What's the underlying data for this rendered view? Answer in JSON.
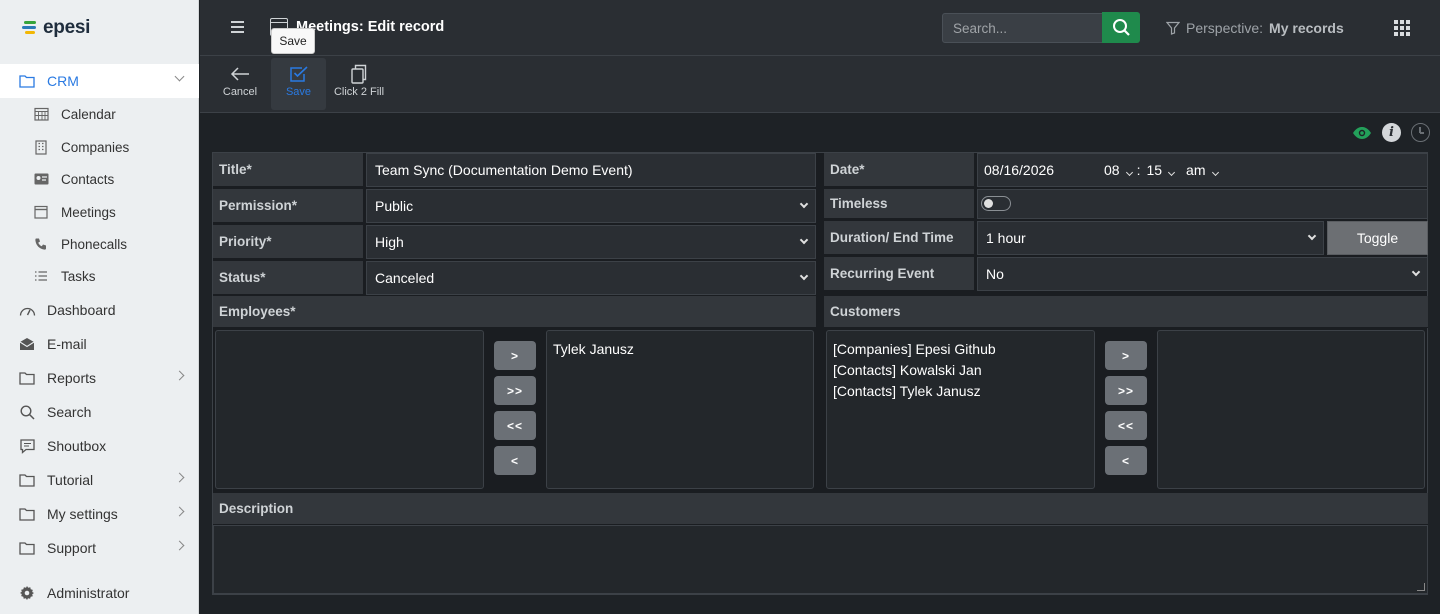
{
  "app": {
    "logo_text": "epesi"
  },
  "sidebar": {
    "crm": {
      "label": "CRM"
    },
    "crm_items": [
      {
        "label": "Calendar",
        "icon": "calendar-grid-icon"
      },
      {
        "label": "Companies",
        "icon": "building-icon"
      },
      {
        "label": "Contacts",
        "icon": "id-card-icon"
      },
      {
        "label": "Meetings",
        "icon": "calendar-icon"
      },
      {
        "label": "Phonecalls",
        "icon": "phone-icon"
      },
      {
        "label": "Tasks",
        "icon": "list-icon"
      }
    ],
    "items": [
      {
        "label": "Dashboard",
        "icon": "gauge-icon"
      },
      {
        "label": "E-mail",
        "icon": "envelope-icon"
      },
      {
        "label": "Reports",
        "icon": "folder-icon"
      },
      {
        "label": "Search",
        "icon": "search-icon"
      },
      {
        "label": "Shoutbox",
        "icon": "chat-icon"
      },
      {
        "label": "Tutorial",
        "icon": "folder-icon"
      },
      {
        "label": "My settings",
        "icon": "folder-icon"
      },
      {
        "label": "Support",
        "icon": "folder-icon"
      }
    ],
    "admin": {
      "label": "Administrator",
      "icon": "gear-icon"
    }
  },
  "header": {
    "title": "Meetings: Edit record",
    "search_placeholder": "Search...",
    "perspective_label": "Perspective:",
    "perspective_value": "My records"
  },
  "toolbar": {
    "cancel": "Cancel",
    "save": "Save",
    "click2fill": "Click 2 Fill",
    "tooltip": "Save"
  },
  "form": {
    "title_label": "Title*",
    "title_value": "Team Sync (Documentation Demo Event)",
    "permission_label": "Permission*",
    "permission_value": "Public",
    "priority_label": "Priority*",
    "priority_value": "High",
    "status_label": "Status*",
    "status_value": "Canceled",
    "date_label": "Date*",
    "date_value": "08/16/2026",
    "hour_value": "08",
    "time_sep": ":",
    "minute_value": "15",
    "ampm_value": "am",
    "timeless_label": "Timeless",
    "duration_label": "Duration/ End Time",
    "duration_value": "1 hour",
    "toggle_label": "Toggle",
    "recurring_label": "Recurring Event",
    "recurring_value": "No",
    "employees_label": "Employees*",
    "employees_selected": [
      "Tylek Janusz"
    ],
    "customers_label": "Customers",
    "customers_available": [
      "[Companies] Epesi Github",
      "[Contacts] Kowalski Jan",
      "[Contacts] Tylek Janusz"
    ],
    "move_buttons": [
      ">",
      ">>",
      "<<",
      "<"
    ],
    "description_label": "Description"
  },
  "colors": {
    "accent": "#2a7ae2",
    "search_green": "#1f8a4c",
    "eye_green": "#23a05a"
  }
}
